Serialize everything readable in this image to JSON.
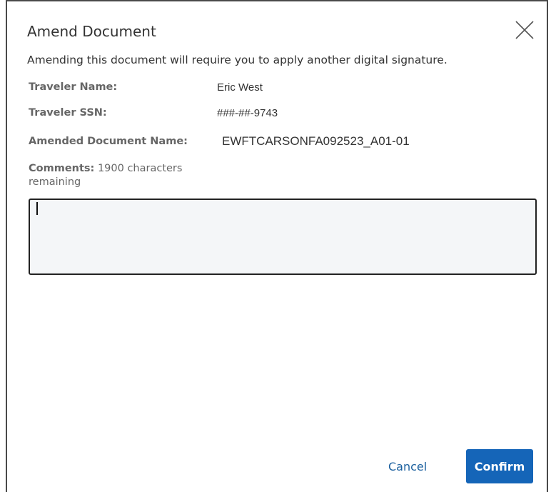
{
  "dialog": {
    "title": "Amend Document",
    "intro": "Amending this document will require you to apply another digital signature.",
    "fields": {
      "traveler_name_label": "Traveler Name:",
      "traveler_name_value": "Eric West",
      "traveler_ssn_label": "Traveler SSN:",
      "traveler_ssn_value": "###-##-9743",
      "amended_doc_label": "Amended Document Name:",
      "amended_doc_value": "EWFTCARSONFA092523_A01-01"
    },
    "comments": {
      "label": "Comments:",
      "remaining": "1900 characters remaining",
      "value": ""
    },
    "buttons": {
      "cancel": "Cancel",
      "confirm": "Confirm"
    },
    "icons": {
      "close": "close-icon"
    },
    "colors": {
      "primary": "#1565b8",
      "link": "#1a5f9e",
      "label": "#666666",
      "text": "#333333"
    }
  }
}
